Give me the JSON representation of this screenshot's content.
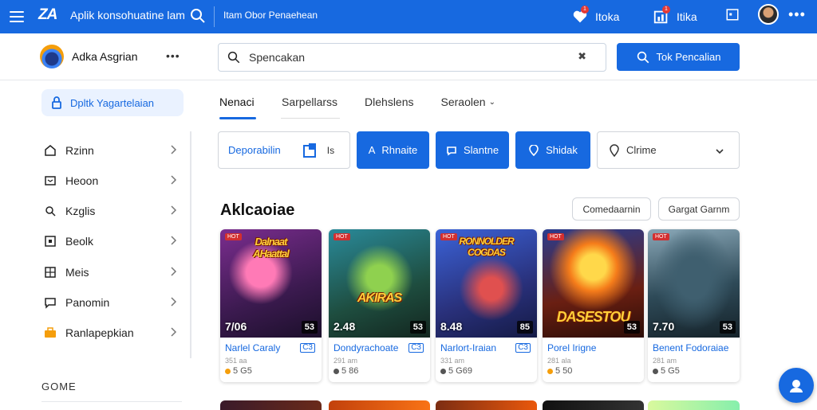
{
  "topbar": {
    "logo": "ZA",
    "app_title": "Aplik konsohuatine lam",
    "subtitle": "Itam Obor Penaehean",
    "btn1_label": "Itoka",
    "btn1_badge": "1",
    "btn2_label": "Itika",
    "btn2_badge": "1",
    "bg_color": "#1769e0"
  },
  "profile": {
    "name": "Adka Asgrian"
  },
  "search": {
    "placeholder": "Spencakan",
    "button_label": "Tok Pencalian"
  },
  "sidebar": {
    "primary": "Dpltk Yagartelaian",
    "items": [
      {
        "label": "Rzinn",
        "icon": "home-icon"
      },
      {
        "label": "Heoon",
        "icon": "box-icon"
      },
      {
        "label": "Kzglis",
        "icon": "search-icon"
      },
      {
        "label": "Beolk",
        "icon": "book-icon"
      },
      {
        "label": "Meis",
        "icon": "grid-icon"
      },
      {
        "label": "Panomin",
        "icon": "chat-icon"
      },
      {
        "label": "Ranlapepkian",
        "icon": "briefcase-icon"
      }
    ],
    "section_label": "GOME"
  },
  "tabs": [
    {
      "label": "Nenaci",
      "active": true
    },
    {
      "label": "Sarpellarss",
      "active": false
    },
    {
      "label": "Dlehslens",
      "active": false
    },
    {
      "label": "Seraolen",
      "active": false
    }
  ],
  "filters": {
    "select1_label": "Deporabilin",
    "select1_suffix": "Is",
    "chip1": "Rhnaite",
    "chip2": "Slantne",
    "chip3": "Shidak",
    "select2_label": "Clrime"
  },
  "section": {
    "heading": "Aklcaoiae",
    "pill1": "Comedaarnin",
    "pill2": "Gargat Garnm"
  },
  "cards": [
    {
      "art_label": "Dalnaat\nAHaattal",
      "score": "7/06",
      "tag": "53",
      "title": "Narlel Caraly",
      "ctag": "C3",
      "sub": "351 aa",
      "rating": "5 G5",
      "rating_color": "#f59e0b",
      "theme": "purple"
    },
    {
      "art_label": "AKIRAS",
      "score": "2.48",
      "tag": "53",
      "title": "Dondyrachoate",
      "ctag": "C3",
      "sub": "291 am",
      "rating": "5 86",
      "rating_color": "#555555",
      "theme": "teal"
    },
    {
      "art_label": "RONNOLDER\nCOGDAS",
      "score": "8.48",
      "tag": "85",
      "title": "Narlort-Iraian",
      "ctag": "C3",
      "sub": "331 am",
      "rating": "5 G69",
      "rating_color": "#555555",
      "theme": "blue"
    },
    {
      "art_label": "DASESTOU",
      "score": "",
      "tag": "53",
      "title": "Porel Irigne",
      "ctag": "",
      "sub": "281 ala",
      "rating": "5 50",
      "rating_color": "#f59e0b",
      "theme": "fire"
    },
    {
      "art_label": "",
      "score": "7.70",
      "tag": "53",
      "title": "Benent Fodoraiae",
      "ctag": "",
      "sub": "281 am",
      "rating": "5 G5",
      "rating_color": "#555555",
      "theme": "dark"
    }
  ]
}
